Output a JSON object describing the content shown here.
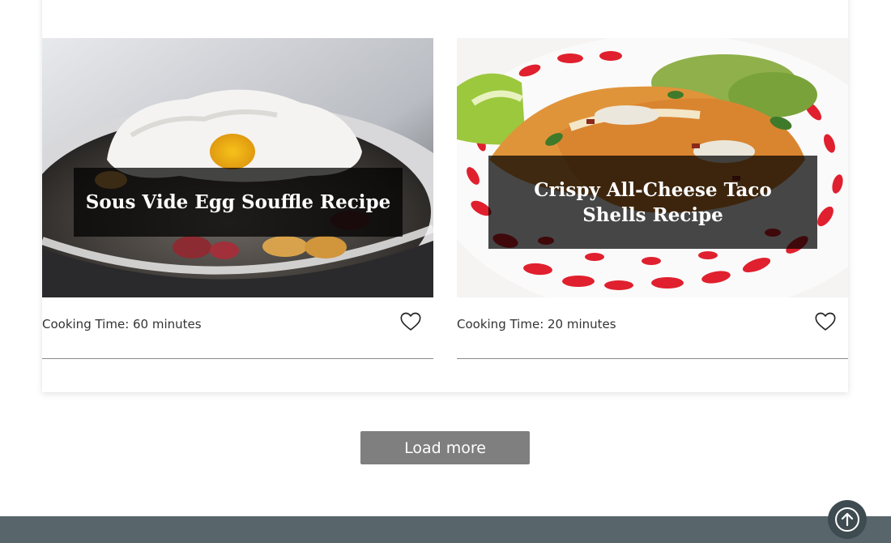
{
  "cards": [
    {
      "title": "Sous Vide Egg Souffle Recipe",
      "cooking_time": "Cooking Time: 60 minutes",
      "favorite_icon": "heart-outline-icon"
    },
    {
      "title": "Crispy All-Cheese Taco Shells Recipe",
      "cooking_time": "Cooking Time: 20 minutes",
      "favorite_icon": "heart-outline-icon"
    }
  ],
  "load_more_label": "Load more",
  "scroll_top_icon": "arrow-up-circle-icon",
  "colors": {
    "button_bg": "#7f7f7f",
    "footer_bg": "#58666b",
    "scroll_top_bg": "#3e4c52",
    "caption_bg": "rgba(0,0,0,0.72)"
  }
}
